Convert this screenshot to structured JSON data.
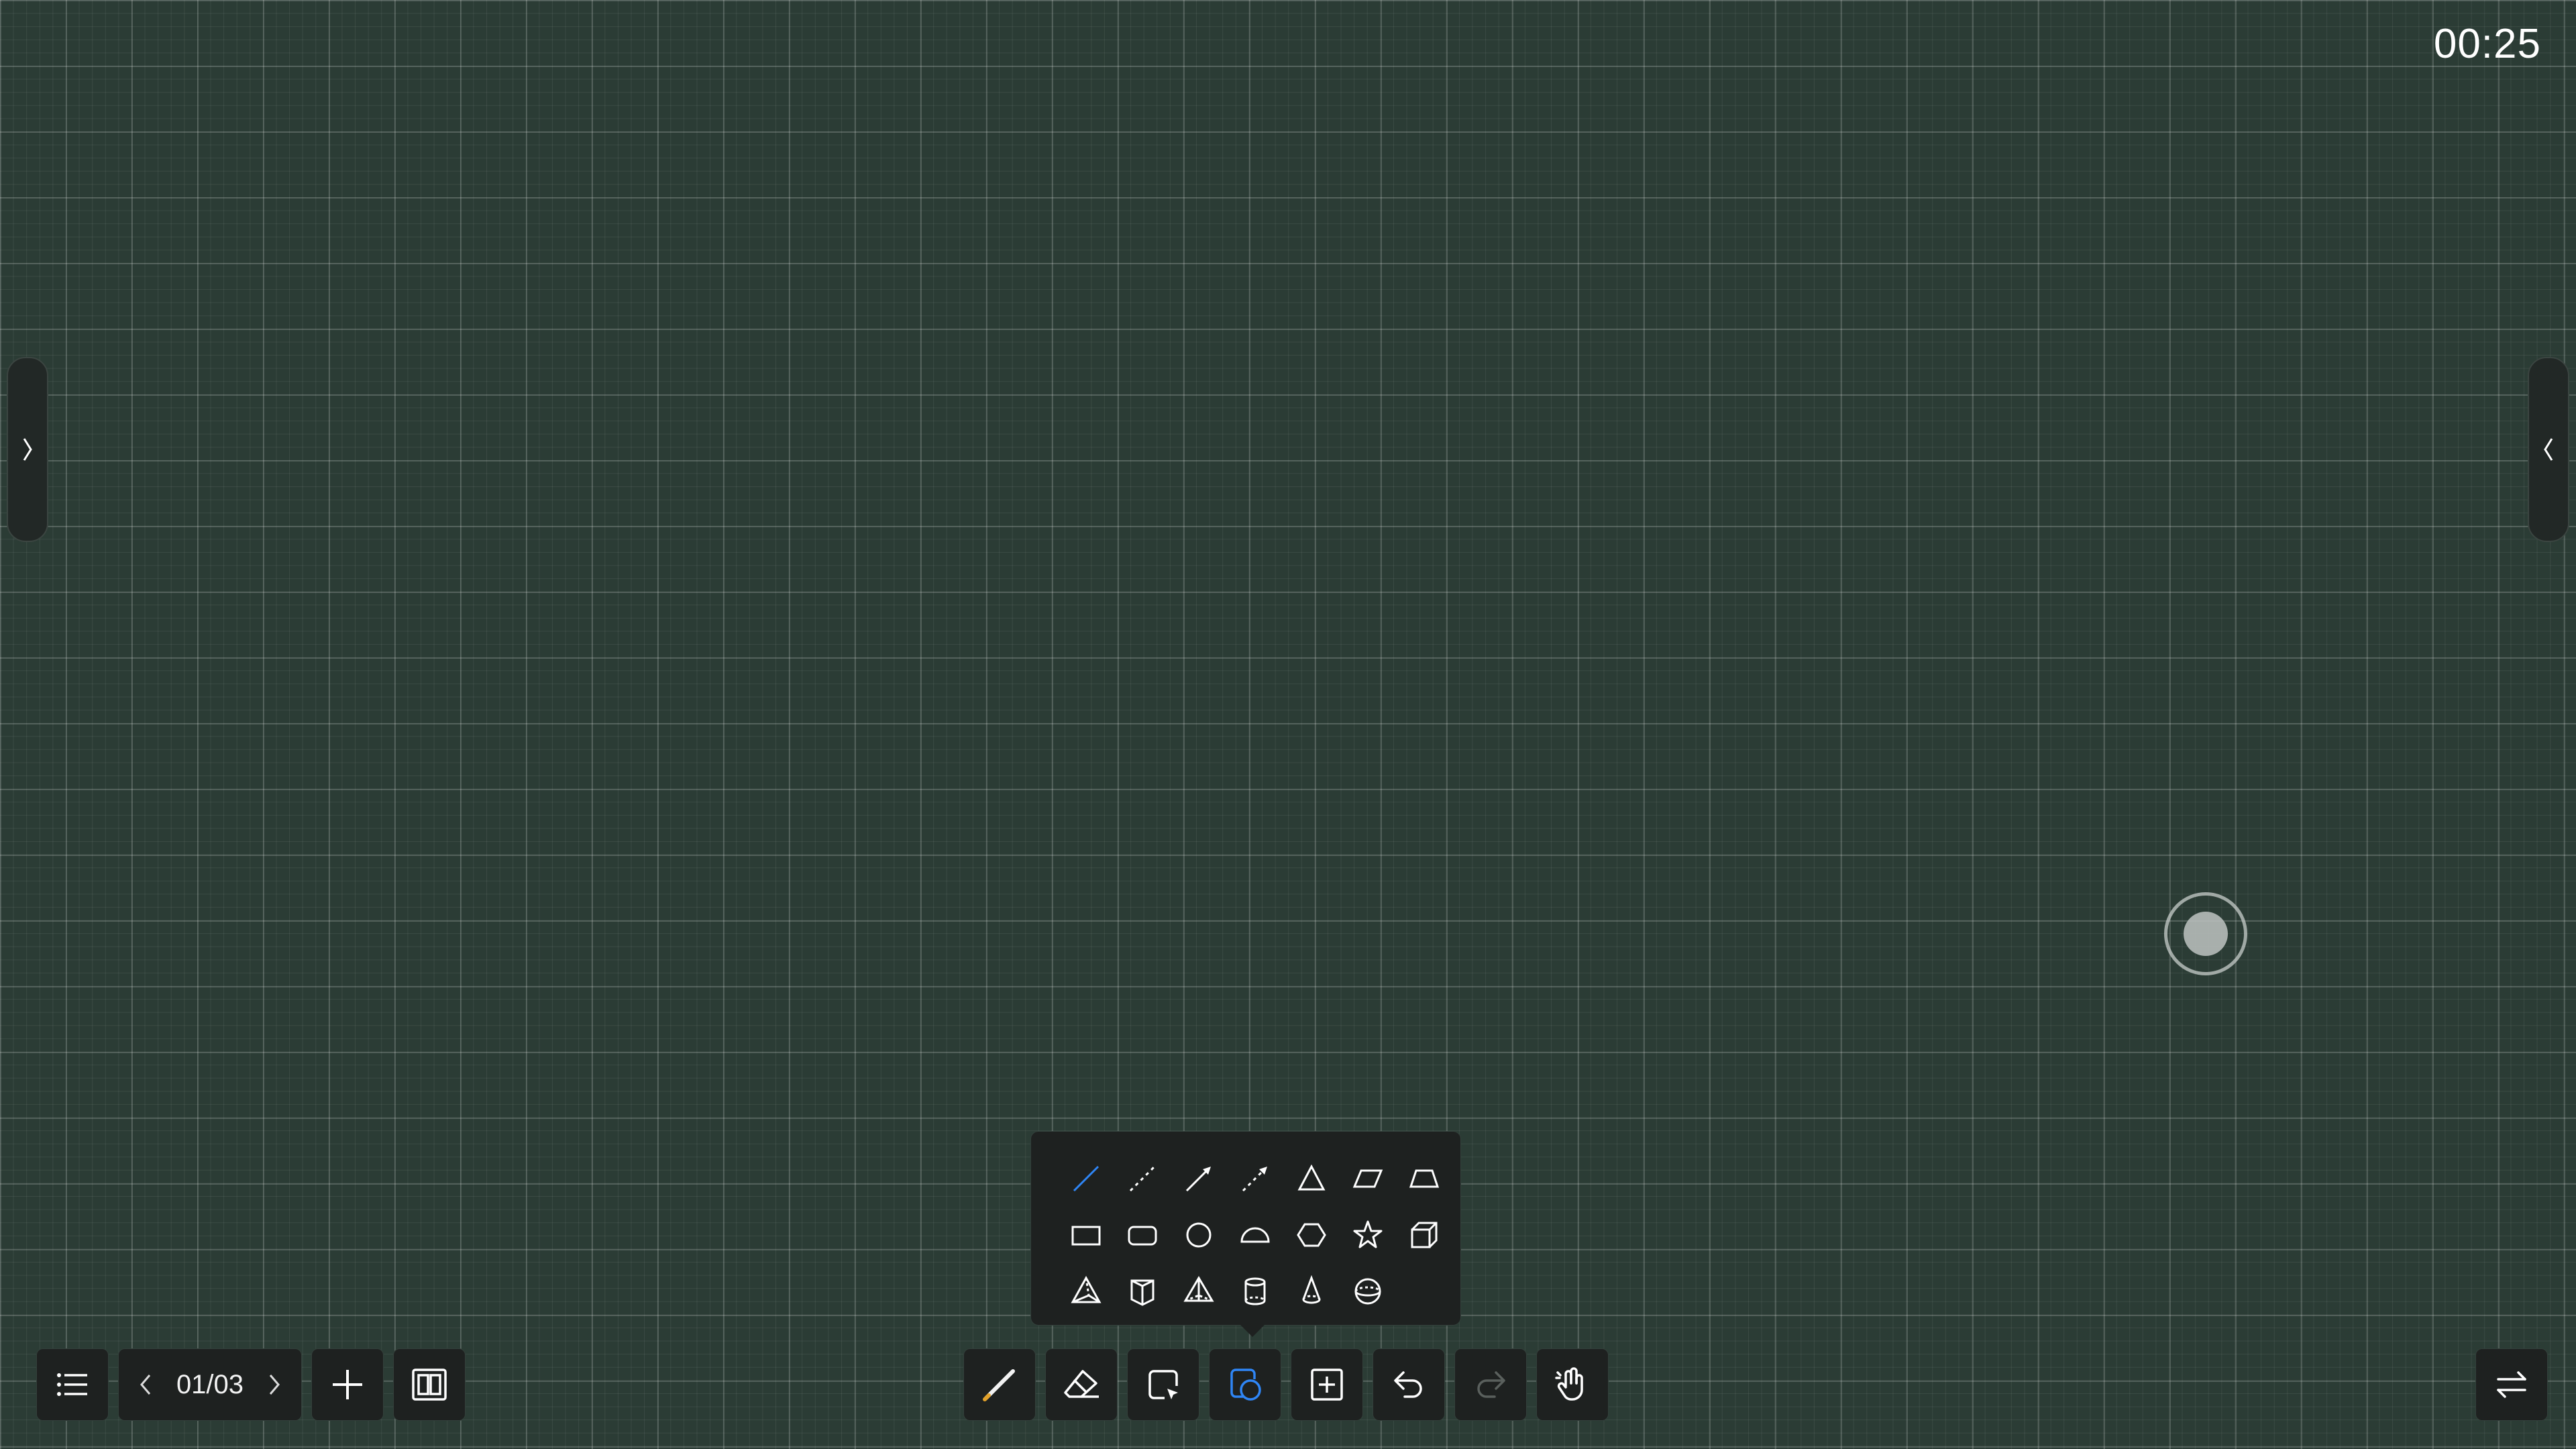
{
  "clock": {
    "time": "00:25"
  },
  "side_tabs": {
    "left_icon": "chevron-right-icon",
    "right_icon": "chevron-left-icon"
  },
  "floating_button": {
    "icon": "floating-assist-icon"
  },
  "bottom_left": {
    "menu_icon": "list-menu-icon",
    "pager": {
      "current": "01/03",
      "prev_icon": "chevron-left-icon",
      "next_icon": "chevron-right-icon"
    },
    "add_icon": "plus-icon",
    "overview_icon": "page-overview-icon"
  },
  "toolbar": {
    "tools": [
      {
        "name": "pen-tool",
        "icon": "pen-icon",
        "active": false
      },
      {
        "name": "eraser-tool",
        "icon": "eraser-icon",
        "active": false
      },
      {
        "name": "select-tool",
        "icon": "select-icon",
        "active": false
      },
      {
        "name": "shape-tool",
        "icon": "shapes-icon",
        "active": true
      },
      {
        "name": "insert-tool",
        "icon": "insert-icon",
        "active": false
      },
      {
        "name": "undo-tool",
        "icon": "undo-icon",
        "active": false
      },
      {
        "name": "redo-tool",
        "icon": "redo-icon",
        "active": false,
        "disabled": true
      },
      {
        "name": "gesture-tool",
        "icon": "hand-gesture-icon",
        "active": false
      }
    ]
  },
  "shape_popup": {
    "selected": "line",
    "shapes": [
      "line",
      "dashed-line",
      "arrow",
      "double-arrow",
      "triangle",
      "parallelogram",
      "trapezoid",
      "rectangle",
      "rounded-rectangle",
      "circle",
      "semicircle",
      "hexagon",
      "star",
      "cube",
      "triangular-pyramid",
      "prism",
      "tetrahedron",
      "cylinder",
      "cone",
      "sphere"
    ]
  },
  "bottom_right": {
    "switch_icon": "switch-sides-icon"
  },
  "colors": {
    "accent": "#2f86f6",
    "background": "#2b3c35",
    "panel": "#1e2120",
    "icon": "#ffffff",
    "disabled": "#5a605d"
  }
}
